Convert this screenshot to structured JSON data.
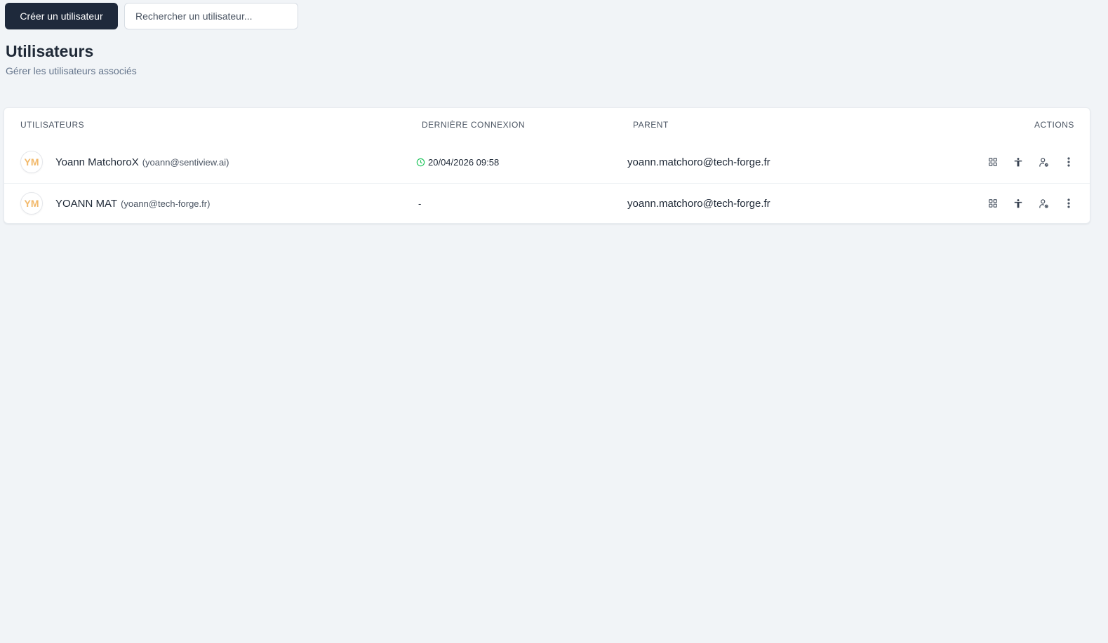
{
  "toolbar": {
    "create_label": "Créer un utilisateur",
    "search_placeholder": "Rechercher un utilisateur..."
  },
  "header": {
    "title": "Utilisateurs",
    "subtitle": "Gérer les utilisateurs associés"
  },
  "table": {
    "columns": {
      "users": "UTILISATEURS",
      "last_login": "DERNIÈRE CONNEXION",
      "parent": "PARENT",
      "actions": "ACTIONS"
    },
    "rows": [
      {
        "initials": "YM",
        "name": "Yoann MatchoroX",
        "email": "(yoann@sentiview.ai)",
        "last_login": "20/04/2026 09:58",
        "parent": "yoann.matchoro@tech-forge.fr"
      },
      {
        "initials": "YM",
        "name": "YOANN MAT",
        "email": "(yoann@tech-forge.fr)",
        "last_login": "-",
        "parent": "yoann.matchoro@tech-forge.fr"
      }
    ]
  },
  "icons": {
    "row_actions": [
      "grid-icon",
      "accessibility-icon",
      "user-settings-icon",
      "more-vertical-icon"
    ],
    "last_login": "clock-icon"
  },
  "colors": {
    "primary_button": "#1e293b",
    "avatar_text": "#f2b96b",
    "clock": "#22c55e",
    "background": "#f1f4f7"
  }
}
